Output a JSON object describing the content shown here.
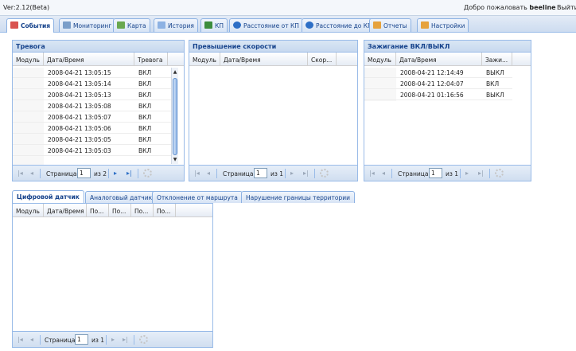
{
  "app": {
    "version": "Ver:2.12(Beta)",
    "welcome_prefix": "Добро пожаловать",
    "username": "beeline",
    "exit_label": "Выйти"
  },
  "main_tabs": [
    {
      "label": "События",
      "icon": "events-icon",
      "color": "#d9534f",
      "active": true
    },
    {
      "label": "Мониторинг",
      "icon": "monitoring-icon",
      "color": "#7a9ec9"
    },
    {
      "label": "Карта",
      "icon": "map-icon",
      "color": "#6aa84f"
    },
    {
      "label": "История",
      "icon": "history-icon",
      "color": "#8db2e3"
    },
    {
      "label": "КП",
      "icon": "checkpoint-icon",
      "color": "#3c8d3c"
    },
    {
      "label": "Расстояние от КП",
      "icon": "distance-from-icon",
      "color": "#2d6fc6"
    },
    {
      "label": "Расстояние до КП",
      "icon": "distance-to-icon",
      "color": "#2d6fc6"
    },
    {
      "label": "Отчеты",
      "icon": "reports-icon",
      "color": "#e6a23c"
    },
    {
      "label": "Настройки",
      "icon": "settings-icon",
      "color": "#e6a23c"
    }
  ],
  "alarm_panel": {
    "title": "Тревога",
    "columns": [
      "Модуль",
      "Дата/Время",
      "Тревога"
    ],
    "rows": [
      [
        "",
        "2008-04-21 13:05:15",
        "ВКЛ"
      ],
      [
        "",
        "2008-04-21 13:05:14",
        "ВКЛ"
      ],
      [
        "",
        "2008-04-21 13:05:13",
        "ВКЛ"
      ],
      [
        "",
        "2008-04-21 13:05:08",
        "ВКЛ"
      ],
      [
        "",
        "2008-04-21 13:05:07",
        "ВКЛ"
      ],
      [
        "",
        "2008-04-21 13:05:06",
        "ВКЛ"
      ],
      [
        "",
        "2008-04-21 13:05:05",
        "ВКЛ"
      ],
      [
        "",
        "2008-04-21 13:05:03",
        "ВКЛ"
      ]
    ],
    "pager": {
      "page_label": "Страница",
      "page": "1",
      "of_label": "из 2"
    }
  },
  "speed_panel": {
    "title": "Превышение скорости",
    "columns": [
      "Модуль",
      "Дата/Время",
      "Скор..."
    ],
    "rows": [],
    "pager": {
      "page_label": "Страница",
      "page": "1",
      "of_label": "из 1"
    }
  },
  "ignition_panel": {
    "title": "Зажигание ВКЛ/ВЫКЛ",
    "columns": [
      "Модуль",
      "Дата/Время",
      "Зажи..."
    ],
    "rows": [
      [
        "",
        "2008-04-21 12:14:49",
        "ВЫКЛ"
      ],
      [
        "",
        "2008-04-21 12:04:07",
        "ВКЛ"
      ],
      [
        "",
        "2008-04-21 01:16:56",
        "ВЫКЛ"
      ]
    ],
    "pager": {
      "page_label": "Страница",
      "page": "1",
      "of_label": "из 1"
    }
  },
  "bottom_tabs": [
    "Цифровой датчик",
    "Аналоговый датчик",
    "Отклонение от маршрута",
    "Нарушение границы территории"
  ],
  "digital_panel": {
    "columns": [
      "Модуль",
      "Дата/Время",
      "По...",
      "По...",
      "По...",
      "По..."
    ],
    "rows": [],
    "pager": {
      "page_label": "Страница",
      "page": "1",
      "of_label": "из 1"
    }
  }
}
